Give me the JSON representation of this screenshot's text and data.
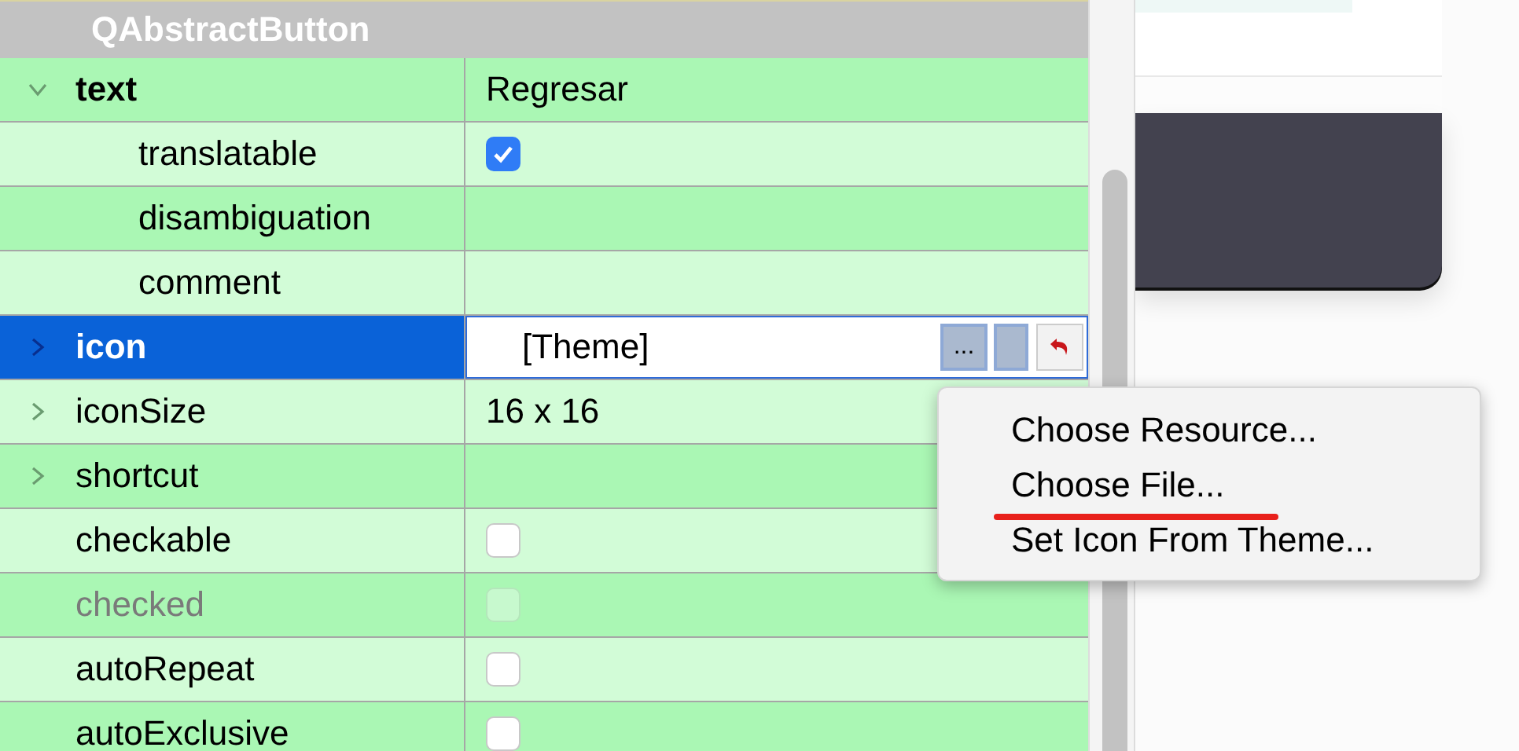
{
  "section": {
    "title": "QAbstractButton"
  },
  "properties": [
    {
      "name": "text",
      "kind": "text",
      "value": "Regresar",
      "bold": true,
      "expanded": true,
      "selected": false,
      "disabled": false,
      "children": [
        {
          "name": "translatable",
          "kind": "checkbox",
          "checked": true,
          "bold": false,
          "selected": false,
          "disabled": false
        },
        {
          "name": "disambiguation",
          "kind": "text",
          "bold": false,
          "selected": false,
          "disabled": false
        },
        {
          "name": "comment",
          "kind": "text",
          "bold": false,
          "selected": false,
          "disabled": false
        }
      ]
    },
    {
      "name": "icon",
      "kind": "editor",
      "value": "[Theme]",
      "bold": true,
      "expanded": false,
      "selected": true,
      "disabled": false
    },
    {
      "name": "iconSize",
      "kind": "text",
      "value": "16 x 16",
      "bold": false,
      "expanded": false,
      "selected": false,
      "disabled": false
    },
    {
      "name": "shortcut",
      "kind": "text",
      "bold": false,
      "expanded": false,
      "selected": false,
      "disabled": false
    },
    {
      "name": "checkable",
      "kind": "checkbox",
      "checked": false,
      "bold": false,
      "selected": false,
      "disabled": false
    },
    {
      "name": "checked",
      "kind": "checkbox",
      "checked": false,
      "bold": false,
      "selected": false,
      "disabled": true
    },
    {
      "name": "autoRepeat",
      "kind": "checkbox",
      "checked": false,
      "bold": false,
      "selected": false,
      "disabled": false
    },
    {
      "name": "autoExclusive",
      "kind": "checkbox",
      "checked": false,
      "bold": false,
      "selected": false,
      "disabled": false
    }
  ],
  "editor_buttons": [
    "..."
  ],
  "menu": {
    "items": [
      {
        "label": "Choose Resource...",
        "underlined": false
      },
      {
        "label": "Choose File...",
        "underlined": true
      },
      {
        "label": "Set Icon From Theme...",
        "underlined": false
      }
    ]
  }
}
